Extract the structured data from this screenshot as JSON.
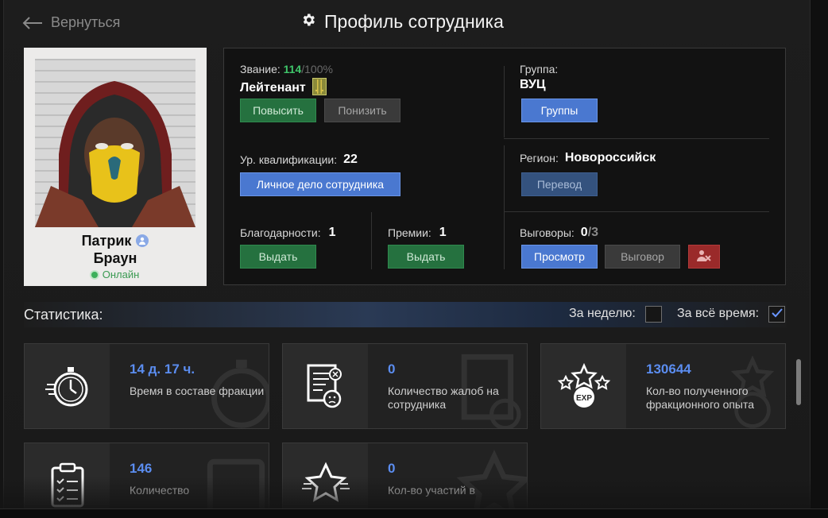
{
  "header": {
    "back_label": "Вернуться",
    "title": "Профиль сотрудника"
  },
  "profile": {
    "first_name": "Патрик",
    "last_name": "Браун",
    "status": "Онлайн"
  },
  "rank": {
    "label": "Звание:",
    "current": "114",
    "max": "/100%",
    "title": "Лейтенант",
    "promote_label": "Повысить",
    "demote_label": "Понизить"
  },
  "group": {
    "label": "Группа:",
    "value": "ВУЦ",
    "button_label": "Группы"
  },
  "qualification": {
    "label": "Ур. квалификации:",
    "value": "22",
    "button_label": "Личное дело сотрудника"
  },
  "region": {
    "label": "Регион:",
    "value": "Новороссийск",
    "button_label": "Перевод"
  },
  "thanks": {
    "label": "Благодарности:",
    "value": "1",
    "button_label": "Выдать"
  },
  "bonuses": {
    "label": "Премии:",
    "value": "1",
    "button_label": "Выдать"
  },
  "reprimands": {
    "label": "Выговоры:",
    "value": "0",
    "max": "/3",
    "view_label": "Просмотр",
    "reprimand_label": "Выговор"
  },
  "stats": {
    "title": "Статистика:",
    "week_label": "За неделю:",
    "week_checked": false,
    "all_time_label": "За всё время:",
    "all_time_checked": true,
    "cards": [
      {
        "value": "14 д. 17 ч.",
        "label": "Время в составе фракции",
        "icon": "stopwatch-icon"
      },
      {
        "value": "0",
        "label": "Количество жалоб на сотрудника",
        "icon": "complaint-document-icon"
      },
      {
        "value": "130644",
        "label": "Кол-во полученного фракционного опыта",
        "icon": "exp-stars-icon"
      },
      {
        "value": "146",
        "label": "Количество",
        "icon": "clipboard-checklist-icon"
      },
      {
        "value": "0",
        "label": "Кол-во участий в",
        "icon": "star-icon"
      }
    ]
  },
  "colors": {
    "accent_blue": "#5b8df0",
    "button_green": "#25713f",
    "button_blue": "#4a78d0",
    "online_green": "#3bb05a",
    "rank_green": "#3fc56a"
  }
}
